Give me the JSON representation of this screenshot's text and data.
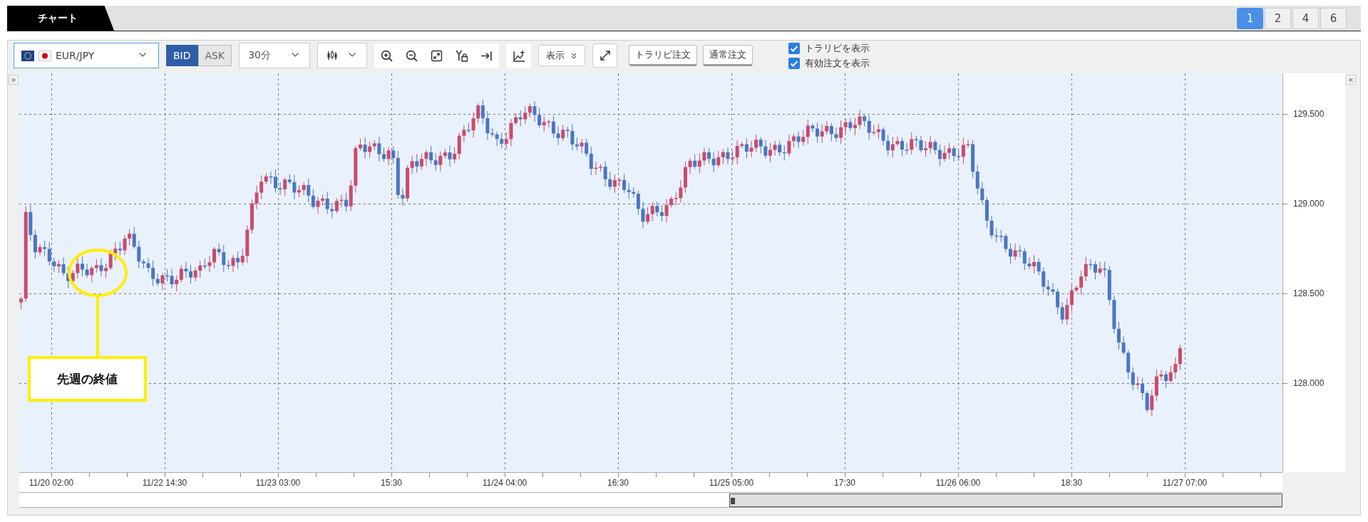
{
  "tabs": [
    {
      "label": "チャート",
      "selected": true
    }
  ],
  "layout_buttons": [
    {
      "label": "1",
      "selected": true
    },
    {
      "label": "2",
      "selected": false
    },
    {
      "label": "4",
      "selected": false
    },
    {
      "label": "6",
      "selected": false
    }
  ],
  "toolbar": {
    "symbol": "EUR/JPY",
    "price_sides": [
      {
        "label": "BID",
        "selected": true
      },
      {
        "label": "ASK",
        "selected": false
      }
    ],
    "timeframe": "30分",
    "display_button": "表示",
    "order_buttons": [
      "トラリピ注文",
      "通常注文"
    ],
    "checkboxes": [
      {
        "label": "トラリピを表示",
        "checked": true
      },
      {
        "label": "有効注文を表示",
        "checked": true
      }
    ]
  },
  "chart": {
    "collapse_left": "»",
    "collapse_right": "«",
    "price_labels": [
      "129.500",
      "129.000",
      "128.500",
      "128.000"
    ],
    "time_labels": [
      "11/20 02:00",
      "11/22 14:30",
      "11/23 03:00",
      "15:30",
      "11/24 04:00",
      "16:30",
      "11/25 05:00",
      "17:30",
      "11/26 06:00",
      "18:30",
      "11/27 07:00"
    ],
    "annotation": "先週の終値"
  }
}
